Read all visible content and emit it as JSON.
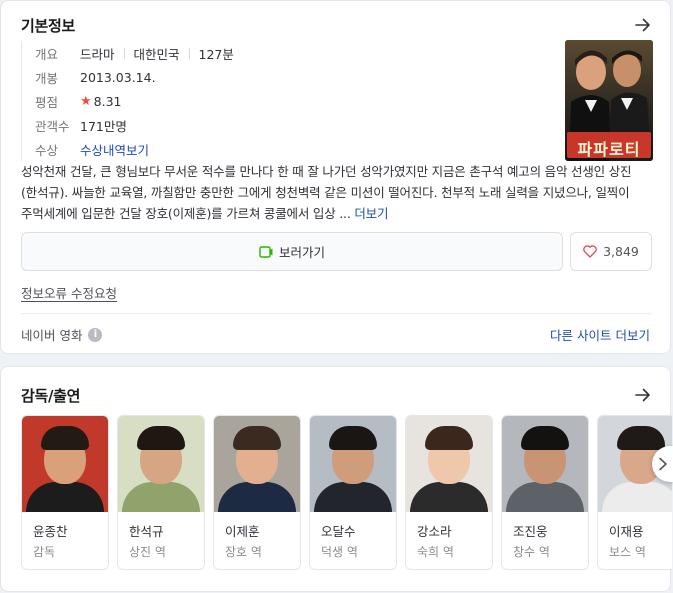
{
  "info": {
    "title": "기본정보",
    "labels": {
      "overview": "개요",
      "release": "개봉",
      "rating": "평점",
      "audience": "관객수",
      "awards": "수상"
    },
    "overview": {
      "genre": "드라마",
      "country": "대한민국",
      "runtime": "127분"
    },
    "release_date": "2013.03.14.",
    "rating_value": "8.31",
    "audience_value": "171만명",
    "awards_link": "수상내역보기",
    "poster_title": "파파로티",
    "description": "성악천재 건달, 큰 형님보다 무서운 적수를 만나다 한 때 잘 나가던 성악가였지만 지금은 촌구석 예고의 음악 선생인 상진(한석규). 싸늘한 교육열, 까칠함만 충만한 그에게 청천벽력 같은 미션이 떨어진다. 천부적 노래 실력을 지녔으나, 일찍이 주먹세계에 입문한 건달 장호(이제훈)를 가르쳐 콩쿨에서 입상 ...",
    "more_label": "더보기",
    "watch_label": "보러가기",
    "like_count": "3,849",
    "report_label": "정보오류 수정요청",
    "source_label": "네이버 영화",
    "source_info_glyph": "i",
    "other_sites_label": "다른 사이트 더보기"
  },
  "cast": {
    "title": "감독/출연",
    "people": [
      {
        "name": "윤종찬",
        "role": "감독"
      },
      {
        "name": "한석규",
        "role": "상진 역"
      },
      {
        "name": "이제훈",
        "role": "장호 역"
      },
      {
        "name": "오달수",
        "role": "덕생 역"
      },
      {
        "name": "강소라",
        "role": "숙희 역"
      },
      {
        "name": "조진웅",
        "role": "창수 역"
      },
      {
        "name": "이재용",
        "role": "보스 역"
      }
    ]
  },
  "colors": {
    "link": "#1e4ab8",
    "star": "#f04c3a",
    "watch_icon": "#2db400",
    "heart": "#e8474f"
  },
  "icons": {
    "arrow": "arrow-right-icon",
    "star": "star-icon",
    "play": "play-icon",
    "heart": "heart-icon",
    "info": "info-icon",
    "next": "chevron-right-icon"
  }
}
